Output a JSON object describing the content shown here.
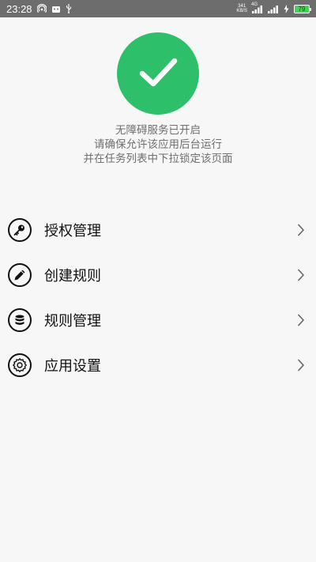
{
  "status_bar": {
    "time": "23:28",
    "net_speed_value": "341",
    "net_speed_unit": "KB/S",
    "network_type": "4G",
    "battery_level": "79",
    "icons": [
      "hotspot-icon",
      "android-icon",
      "usb-icon",
      "signal-icon",
      "signal-icon-2",
      "charging-icon",
      "battery-icon"
    ]
  },
  "status_check": {
    "icon": "check-icon",
    "color": "#2ebf6a"
  },
  "message": {
    "line1": "无障碍服务已开启",
    "line2": "请确保允许该应用后台运行",
    "line3": "并在任务列表中下拉锁定该页面"
  },
  "menu": {
    "items": [
      {
        "label": "授权管理",
        "icon": "key-icon"
      },
      {
        "label": "创建规则",
        "icon": "pencil-icon"
      },
      {
        "label": "规则管理",
        "icon": "database-icon"
      },
      {
        "label": "应用设置",
        "icon": "gear-icon"
      }
    ]
  }
}
